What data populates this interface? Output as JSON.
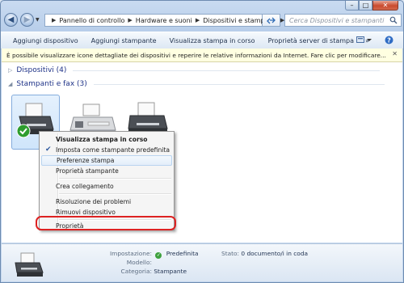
{
  "window": {
    "caption_min": "–",
    "caption_max": "□",
    "caption_close": "✕"
  },
  "nav": {
    "back": "◀",
    "forward": "▶",
    "breadcrumb": [
      "Pannello di controllo",
      "Hardware e suoni",
      "Dispositivi e stampanti"
    ],
    "search_placeholder": "Cerca Dispositivi e stampanti"
  },
  "commands": {
    "items": [
      "Aggiungi dispositivo",
      "Aggiungi stampante",
      "Visualizza stampa in corso",
      "Proprietà server di stampa"
    ],
    "more": "»"
  },
  "infobar": {
    "text": "È possibile visualizzare icone dettagliate dei dispositivi e reperire le relative informazioni da Internet. Fare clic per modificare...",
    "close": "✕"
  },
  "groups": {
    "devices": "Dispositivi (4)",
    "printers": "Stampanti e fax (3)"
  },
  "context_menu": {
    "items": [
      {
        "label": "Visualizza stampa in corso"
      },
      {
        "label": "Imposta come stampante predefinita"
      },
      {
        "label": "Preferenze stampa"
      },
      {
        "label": "Proprietà stampante"
      },
      {
        "label": "Crea collegamento"
      },
      {
        "label": "Risoluzione dei problemi"
      },
      {
        "label": "Rimuovi dispositivo"
      },
      {
        "label": "Proprietà"
      }
    ]
  },
  "details": {
    "impostazione_label": "Impostazione:",
    "impostazione_value": "Predefinita",
    "stato_label": "Stato:",
    "stato_value": "0 documento/i in coda",
    "modello_label": "Modello:",
    "modello_value": "",
    "categoria_label": "Categoria:",
    "categoria_value": "Stampante"
  },
  "colors": {
    "accent": "#1e3287",
    "highlight": "#d22222",
    "ok": "#3ea13e"
  }
}
